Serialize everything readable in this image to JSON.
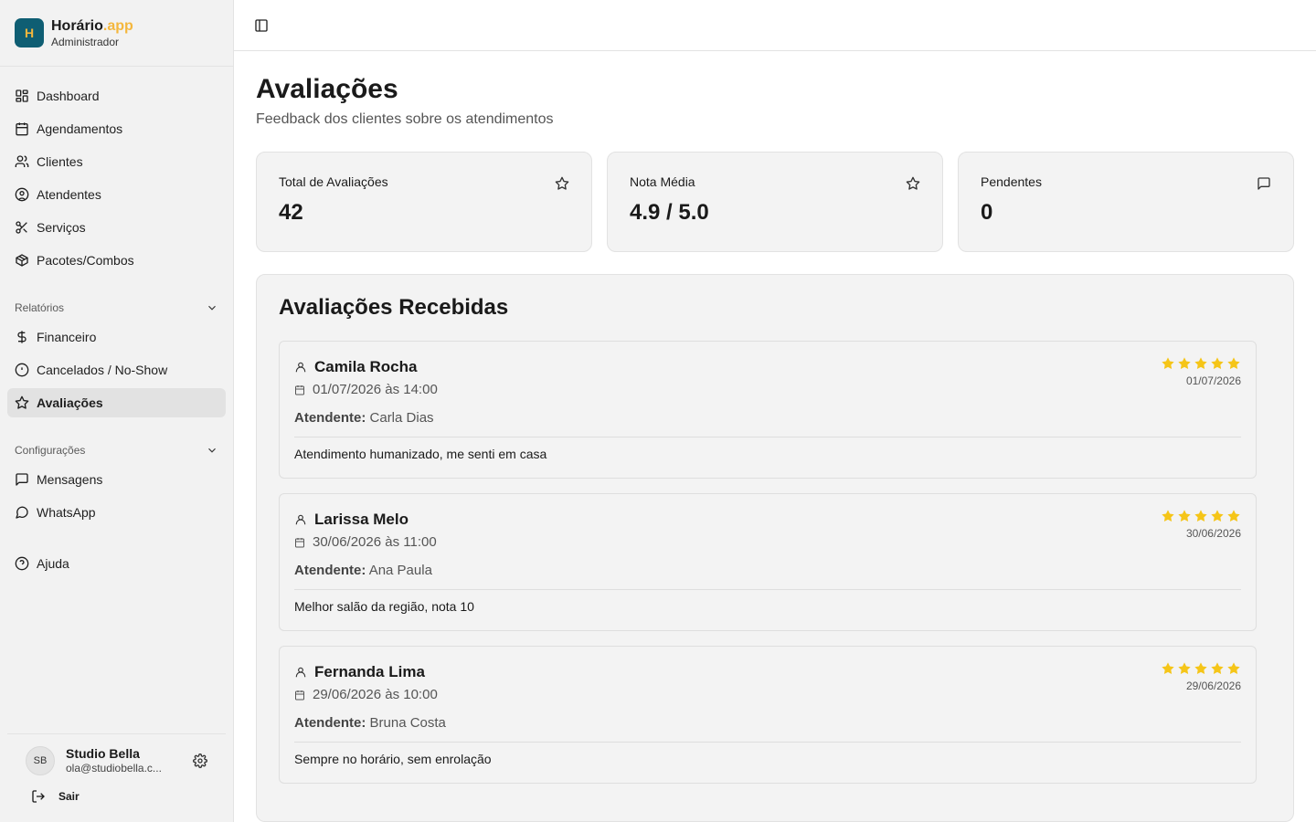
{
  "brand": {
    "initial": "H",
    "name": "Horário",
    "suffix": ".app",
    "role": "Administrador"
  },
  "nav": {
    "main": [
      {
        "label": "Dashboard",
        "icon": "dashboard-icon"
      },
      {
        "label": "Agendamentos",
        "icon": "calendar-icon"
      },
      {
        "label": "Clientes",
        "icon": "users-icon"
      },
      {
        "label": "Atendentes",
        "icon": "user-circle-icon"
      },
      {
        "label": "Serviços",
        "icon": "scissors-icon"
      },
      {
        "label": "Pacotes/Combos",
        "icon": "package-icon"
      }
    ],
    "reports_label": "Relatórios",
    "reports": [
      {
        "label": "Financeiro",
        "icon": "dollar-icon"
      },
      {
        "label": "Cancelados / No-Show",
        "icon": "alert-circle-icon"
      },
      {
        "label": "Avaliações",
        "icon": "star-icon",
        "active": true
      }
    ],
    "settings_label": "Configurações",
    "settings": [
      {
        "label": "Mensagens",
        "icon": "message-square-icon"
      },
      {
        "label": "WhatsApp",
        "icon": "message-circle-icon"
      }
    ],
    "help": {
      "label": "Ajuda",
      "icon": "help-circle-icon"
    }
  },
  "user": {
    "initials": "SB",
    "name": "Studio Bella",
    "email": "ola@studiobella.c...",
    "logout_label": "Sair"
  },
  "page": {
    "title": "Avaliações",
    "subtitle": "Feedback dos clientes sobre os atendimentos"
  },
  "stats": [
    {
      "label": "Total de Avaliações",
      "value": "42",
      "icon": "star-icon"
    },
    {
      "label": "Nota Média",
      "value": "4.9 / 5.0",
      "icon": "star-icon"
    },
    {
      "label": "Pendentes",
      "value": "0",
      "icon": "message-square-icon"
    }
  ],
  "reviews": {
    "title": "Avaliações Recebidas",
    "attendant_label": "Atendente:",
    "items": [
      {
        "client": "Camila Rocha",
        "datetime": "01/07/2026 às 14:00",
        "attendant": "Carla Dias",
        "comment": "Atendimento humanizado, me senti em casa",
        "rating": 5,
        "date": "01/07/2026"
      },
      {
        "client": "Larissa Melo",
        "datetime": "30/06/2026 às 11:00",
        "attendant": "Ana Paula",
        "comment": "Melhor salão da região, nota 10",
        "rating": 5,
        "date": "30/06/2026"
      },
      {
        "client": "Fernanda Lima",
        "datetime": "29/06/2026 às 10:00",
        "attendant": "Bruna Costa",
        "comment": "Sempre no horário, sem enrolação",
        "rating": 5,
        "date": "29/06/2026"
      }
    ]
  },
  "colors": {
    "brand": "#0f5e73",
    "accent": "#f4b73d",
    "star": "#f5c518"
  }
}
